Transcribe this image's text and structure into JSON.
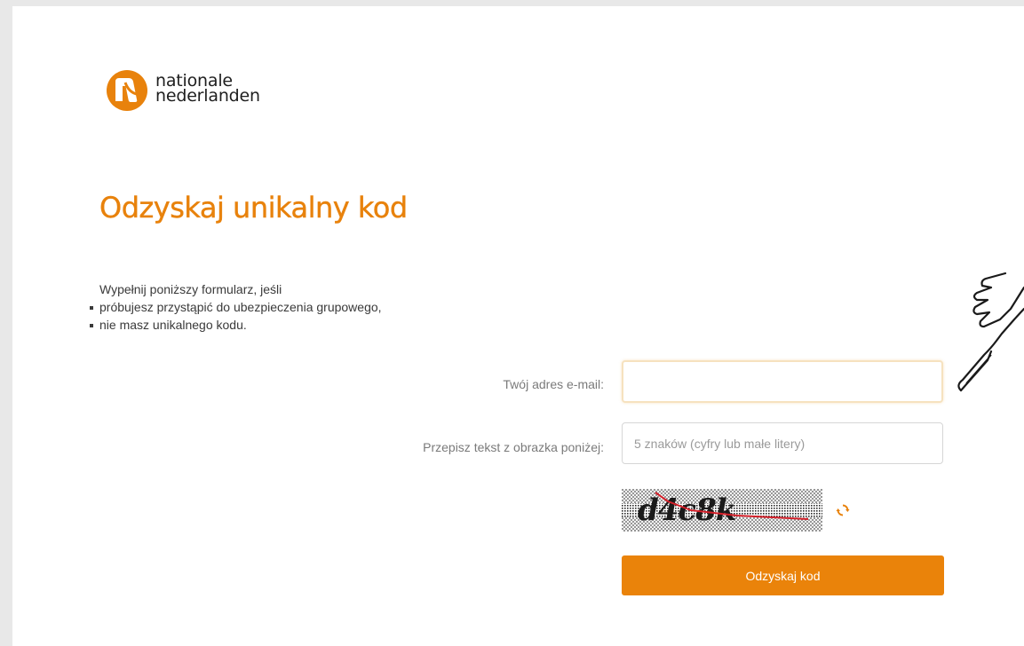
{
  "brand": {
    "line1": "nationale",
    "line2": "nederlanden",
    "logo_icon": "nn-logo-icon",
    "accent_color": "#e8820c"
  },
  "page": {
    "title": "Odzyskaj unikalny kod",
    "intro_lead": "Wypełnij poniższy formularz, jeśli",
    "intro_items": [
      "próbujesz przystąpić do ubezpieczenia grupowego,",
      "nie masz unikalnego kodu."
    ]
  },
  "form": {
    "email_label": "Twój adres e-mail:",
    "email_value": "",
    "email_placeholder": "",
    "captcha_label": "Przepisz tekst z obrazka poniżej:",
    "captcha_value": "",
    "captcha_placeholder": "5 znaków (cyfry lub małe litery)",
    "captcha_text": "d4c8k",
    "refresh_icon": "refresh-icon",
    "submit_label": "Odzyskaj kod",
    "button_color": "#ea830a"
  },
  "overlay": {
    "icon": "pointing-hand-icon"
  }
}
